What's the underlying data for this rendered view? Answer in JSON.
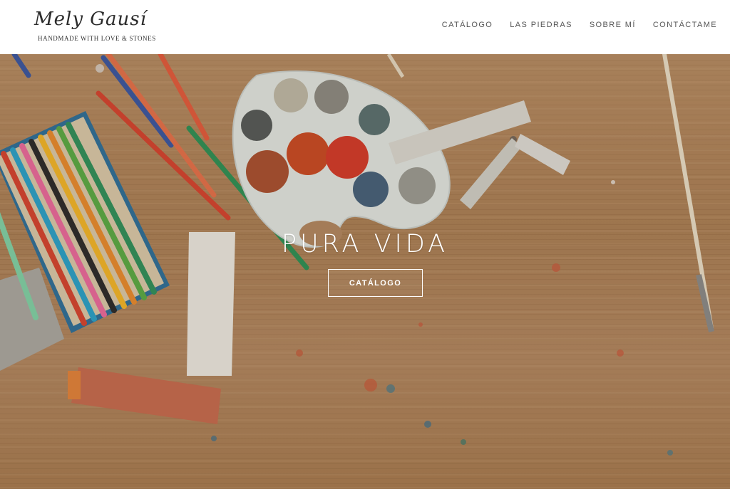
{
  "header": {
    "logo_script": "Mely Gausí",
    "logo_tagline": "HANDMADE WITH LOVE & STONES",
    "nav": [
      "CATÁLOGO",
      "LAS PIEDRAS",
      "SOBRE MÍ",
      "CONTÁCTAME"
    ]
  },
  "hero": {
    "title": "PURA VIDA",
    "button_label": "CATÁLOGO"
  },
  "colors": {
    "header_bg": "#ffffff",
    "nav_text": "#555555",
    "hero_text": "#ffffff",
    "wood": "#b08660"
  }
}
